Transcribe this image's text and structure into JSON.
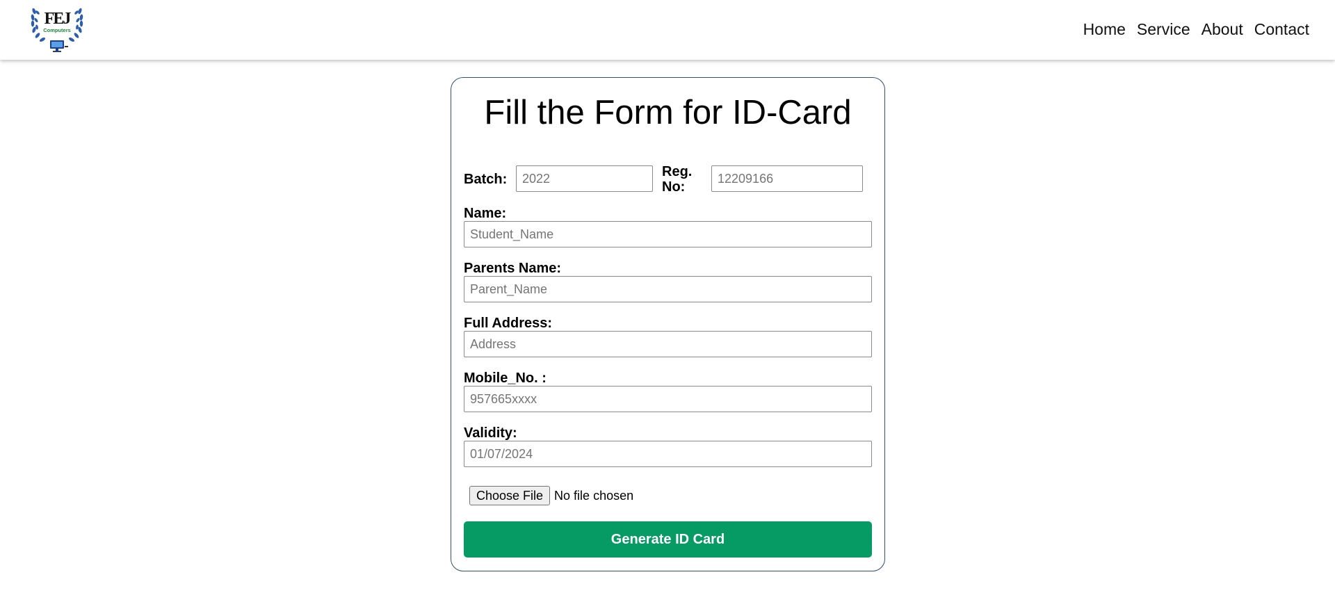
{
  "brand": {
    "logo_text": "FEJ",
    "logo_subtext": "Computers"
  },
  "nav": {
    "items": [
      {
        "label": "Home"
      },
      {
        "label": "Service"
      },
      {
        "label": "About"
      },
      {
        "label": "Contact"
      }
    ]
  },
  "form": {
    "title": "Fill the Form for ID-Card",
    "batch": {
      "label": "Batch:",
      "placeholder": "2022"
    },
    "reg_no": {
      "label_line1": "Reg.",
      "label_line2": "No:",
      "placeholder": "12209166"
    },
    "name": {
      "label": "Name:",
      "placeholder": "Student_Name"
    },
    "parents_name": {
      "label": "Parents Name:",
      "placeholder": "Parent_Name"
    },
    "address": {
      "label": "Full Address:",
      "placeholder": "Address"
    },
    "mobile": {
      "label": "Mobile_No. :",
      "placeholder": "957665xxxx"
    },
    "validity": {
      "label": "Validity:",
      "placeholder": "01/07/2024"
    },
    "file": {
      "button_label": "Choose File",
      "status": "No file chosen"
    },
    "submit_label": "Generate ID Card"
  },
  "colors": {
    "accent_green": "#069a64",
    "card_border": "#2f4f7a",
    "laurel_blue": "#2a5db0",
    "logo_green": "#1c8a3a"
  }
}
